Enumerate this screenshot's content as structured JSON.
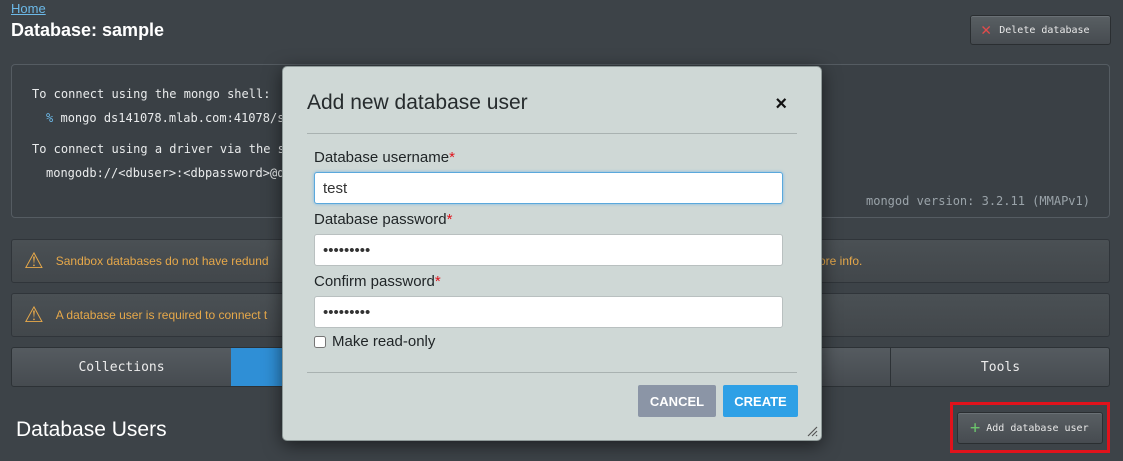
{
  "breadcrumb": "Home",
  "page_title": "Database: sample",
  "delete_button": "Delete database",
  "connect": {
    "shell_label": "To connect using the mongo shell:",
    "shell_prompt": "%",
    "shell_cmd": "mongo ds141078.mlab.com:41078/s",
    "driver_label": "To connect using a driver via the st",
    "driver_uri": "mongodb://<dbuser>:<dbpassword>@d",
    "version": "mongod version: 3.2.11 (MMAPv1)"
  },
  "alerts": {
    "sandbox": "Sandbox databases do not have redund",
    "sandbox_tail": "ore info.",
    "user_required": "A database user is required to connect t"
  },
  "tabs": {
    "collections": "Collections",
    "tools": "Tools"
  },
  "section_title": "Database Users",
  "add_user_button": "Add database user",
  "modal": {
    "title": "Add new database user",
    "close": "×",
    "username_label": "Database username",
    "username_value": "test",
    "password_label": "Database password",
    "password_value": "•••••••••",
    "confirm_label": "Confirm password",
    "confirm_value": "•••••••••",
    "required_mark": "*",
    "readonly_label": "Make read-only",
    "readonly_checked": false,
    "cancel": "CANCEL",
    "create": "CREATE"
  },
  "colors": {
    "accent": "#2ea0e6",
    "warning": "#e6a84a",
    "danger": "#e0121b"
  }
}
